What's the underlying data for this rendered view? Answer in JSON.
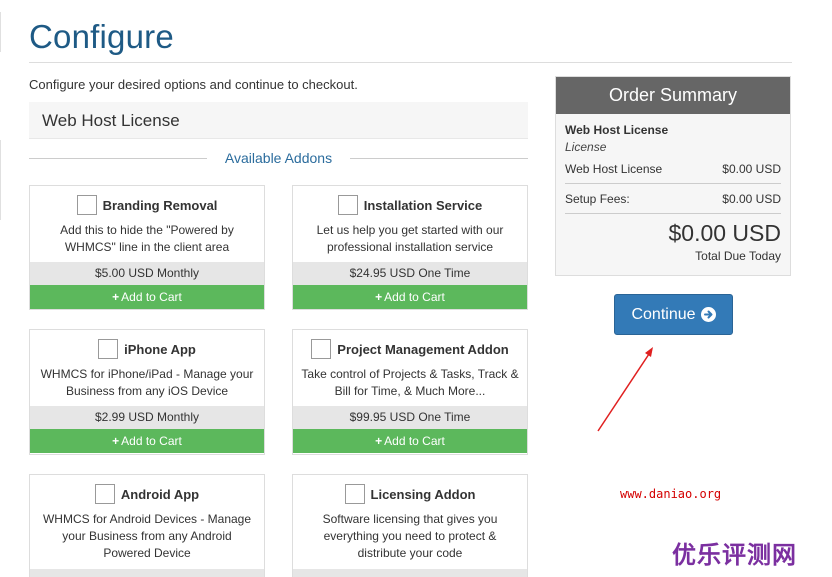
{
  "page": {
    "title": "Configure",
    "intro": "Configure your desired options and continue to checkout."
  },
  "product": {
    "name": "Web Host License"
  },
  "addons_heading": "Available Addons",
  "addons": [
    {
      "name": "Branding Removal",
      "description": "Add this to hide the \"Powered by WHMCS\" line in the client area",
      "price": "$5.00 USD Monthly",
      "cart_label": "Add to Cart",
      "checked": false
    },
    {
      "name": "Installation Service",
      "description": "Let us help you get started with our professional installation service",
      "price": "$24.95 USD One Time",
      "cart_label": "Add to Cart",
      "checked": false
    },
    {
      "name": "iPhone App",
      "description": "WHMCS for iPhone/iPad - Manage your Business from any iOS Device",
      "price": "$2.99 USD Monthly",
      "cart_label": "Add to Cart",
      "checked": false
    },
    {
      "name": "Project Management Addon",
      "description": "Take control of Projects & Tasks, Track & Bill for Time, & Much More...",
      "price": "$99.95 USD One Time",
      "cart_label": "Add to Cart",
      "checked": false
    },
    {
      "name": "Android App",
      "description": "WHMCS for Android Devices - Manage your Business from any Android Powered Device",
      "price": "",
      "cart_label": "",
      "checked": false
    },
    {
      "name": "Licensing Addon",
      "description": "Software licensing that gives you everything you need to protect & distribute your code",
      "price": "",
      "cart_label": "",
      "checked": false
    }
  ],
  "summary": {
    "heading": "Order Summary",
    "product_name": "Web Host License",
    "product_type": "License",
    "line_label": "Web Host License",
    "line_value": "$0.00 USD",
    "setup_label": "Setup Fees:",
    "setup_value": "$0.00 USD",
    "total": "$0.00 USD",
    "total_label": "Total Due Today"
  },
  "continue_label": "Continue",
  "watermark": "www.daniao.org",
  "brand_logo": "优乐评测网",
  "colors": {
    "title": "#1e5a85",
    "cart": "#5cb85c",
    "continue": "#337ab7",
    "summary_head": "#666666",
    "annotation": "#d40000"
  }
}
